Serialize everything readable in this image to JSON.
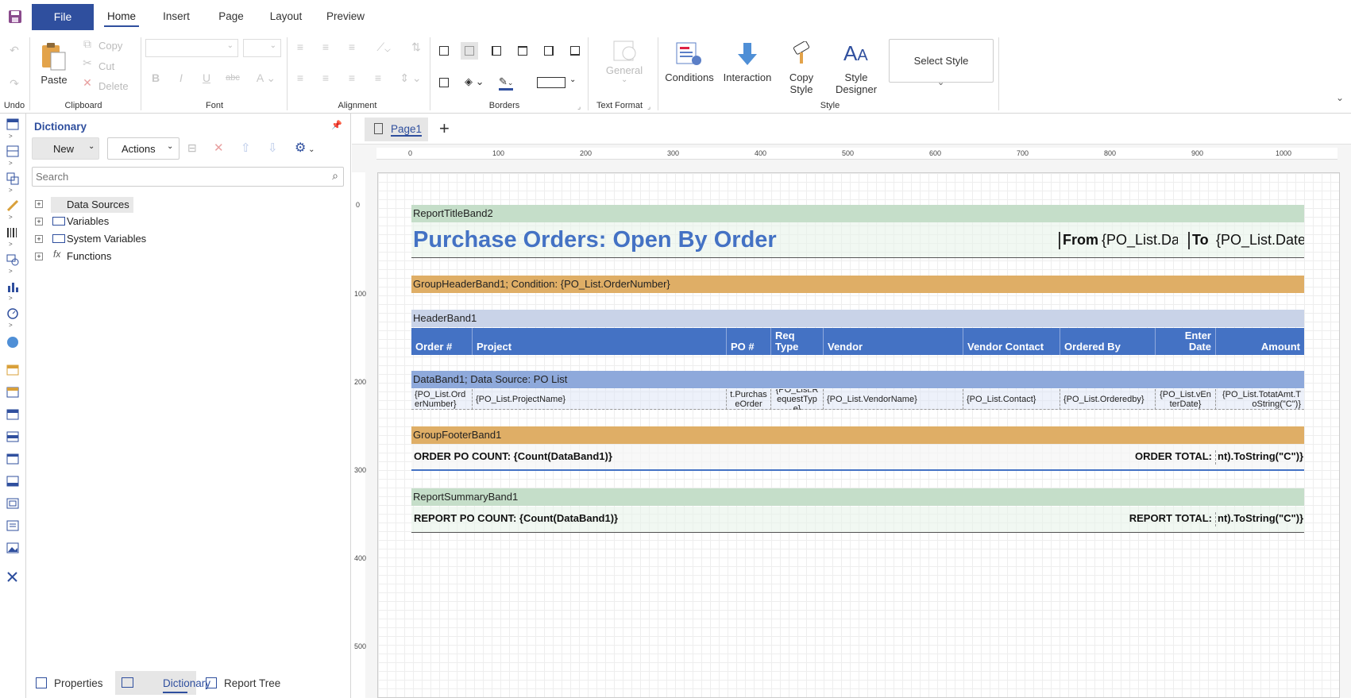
{
  "menubar": {
    "file": "File",
    "tabs": [
      "Home",
      "Insert",
      "Page",
      "Layout",
      "Preview"
    ]
  },
  "ribbon": {
    "undo_label": "Undo",
    "clipboard": {
      "paste": "Paste",
      "copy": "Copy",
      "cut": "Cut",
      "delete": "Delete",
      "label": "Clipboard"
    },
    "font_label": "Font",
    "alignment_label": "Alignment",
    "borders_label": "Borders",
    "text_format": {
      "value": "General",
      "label": "Text Format"
    },
    "style": {
      "conditions": "Conditions",
      "interaction": "Interaction",
      "copy_style": "Copy Style",
      "style_designer": "Style Designer",
      "select_style": "Select Style",
      "label": "Style"
    }
  },
  "dictionary": {
    "title": "Dictionary",
    "new_btn": "New",
    "actions_btn": "Actions",
    "search_placeholder": "Search",
    "tree": [
      "Data Sources",
      "Variables",
      "System Variables",
      "Functions"
    ]
  },
  "bottom_tabs": [
    "Properties",
    "Dictionary",
    "Report Tree"
  ],
  "designer": {
    "page_tab": "Page1",
    "ruler_h": [
      "0",
      "100",
      "200",
      "300",
      "400",
      "500",
      "600",
      "700",
      "800",
      "900",
      "1000"
    ],
    "ruler_v": [
      "0",
      "100",
      "200",
      "300",
      "400",
      "500"
    ]
  },
  "report": {
    "title_band": "ReportTitleBand2",
    "title_text": "Purchase Orders: Open By Order",
    "from_label": "From",
    "from_value": "{PO_List.Da",
    "to_label": "To",
    "to_value": "{PO_List.Date",
    "group_header": "GroupHeaderBand1; Condition: {PO_List.OrderNumber}",
    "header_band": "HeaderBand1",
    "headers": [
      "Order #",
      "Project",
      "PO #",
      "Req Type",
      "Vendor",
      "Vendor Contact",
      "Ordered By",
      "Enter Date",
      "Amount"
    ],
    "data_band": "DataBand1; Data Source: PO List",
    "data_cells": [
      "{PO_List.OrderNumber}",
      "{PO_List.ProjectName}",
      "t.PurchaseOrder",
      "{PO_List.RequestType}",
      "{PO_List.VendorName}",
      "{PO_List.Contact}",
      "{PO_List.Orderedby}",
      "{PO_List.vEnterDate}",
      "{PO_List.TotatAmt.ToString(\"C\")}"
    ],
    "group_footer": "GroupFooterBand1",
    "order_count": "ORDER PO COUNT: {Count(DataBand1)}",
    "order_total_label": "ORDER TOTAL:",
    "order_total_value": "nt).ToString(\"C\")}",
    "summary_band": "ReportSummaryBand1",
    "report_count": "REPORT PO COUNT: {Count(DataBand1)}",
    "report_total_label": "REPORT TOTAL:",
    "report_total_value": "nt).ToString(\"C\")}"
  },
  "colors": {
    "accent": "#2f4f9e",
    "title_blue": "#4472c4",
    "header_band": "#c9d3e8",
    "column_header": "#4472c4",
    "data_band": "#8ea9db",
    "group_band": "#dfae66",
    "title_band": "#c5dec9"
  }
}
